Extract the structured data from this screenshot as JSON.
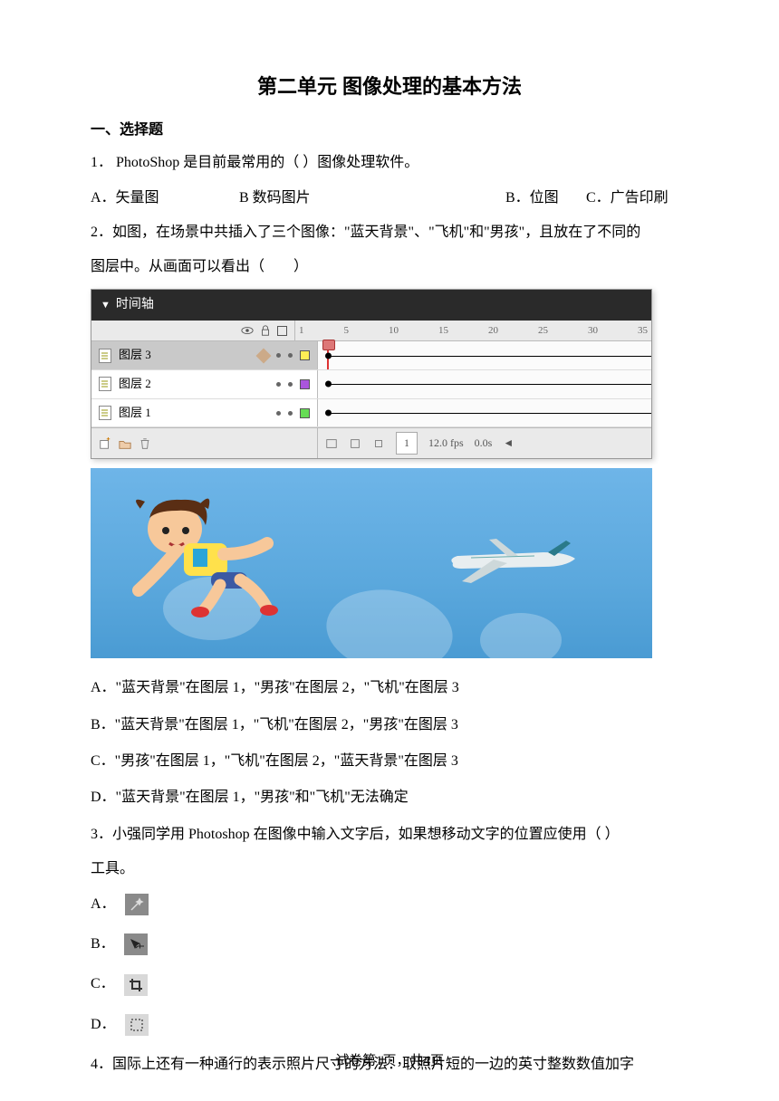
{
  "title": "第二单元 图像处理的基本方法",
  "section1": "一、选择题",
  "q1": {
    "text": "1．  PhotoShop 是目前最常用的（        ）图像处理软件。",
    "a": "A．矢量图",
    "b1": "B 数码图片",
    "b2": "B．位图",
    "c": "C．广告印刷"
  },
  "q2": {
    "l1": "2．如图，在场景中共插入了三个图像：\"蓝天背景\"、\"飞机\"和\"男孩\"，且放在了不同的",
    "l2": "图层中。从画面可以看出（　　）",
    "a": "A．\"蓝天背景\"在图层 1，\"男孩\"在图层 2，\"飞机\"在图层 3",
    "b": "B．\"蓝天背景\"在图层 1，\"飞机\"在图层 2，\"男孩\"在图层 3",
    "c": "C．\"男孩\"在图层 1，\"飞机\"在图层 2，\"蓝天背景\"在图层 3",
    "d": "D．\"蓝天背景\"在图层 1，\"男孩\"和\"飞机\"无法确定"
  },
  "timeline": {
    "header": "时间轴",
    "ticks": [
      "1",
      "5",
      "10",
      "15",
      "20",
      "25",
      "30",
      "35"
    ],
    "layer3": "图层 3",
    "layer2": "图层 2",
    "layer1": "图层 1",
    "frame": "1",
    "fps": "12.0 fps",
    "time": "0.0s"
  },
  "q3": {
    "l1": "3．小强同学用 Photoshop 在图像中输入文字后，如果想移动文字的位置应使用（        ）",
    "l2": "工具。",
    "a": "A．",
    "b": "B．",
    "c": "C．",
    "d": "D．"
  },
  "q4": "4．国际上还有一种通行的表示照片尺寸的方法：取照片短的一边的英寸整数数值加字",
  "footer": "试卷第1页，共4页"
}
